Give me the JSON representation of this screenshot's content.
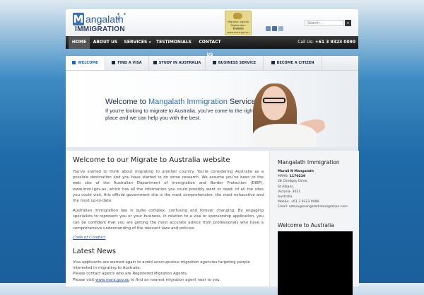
{
  "logo": {
    "brand": "angalath",
    "initial": "M",
    "sub": "IMMIGRATION"
  },
  "badge": {
    "line1": "Migration Agents",
    "line2": "Registration Number",
    "line3": "1170229",
    "line4": "www.mara.gov.au"
  },
  "search": {
    "placeholder": "Search..."
  },
  "nav": {
    "items": [
      "HOME",
      "ABOUT US",
      "SERVICES ▫",
      "TESTIMONIALS",
      "CONTACT US"
    ],
    "phone_label": "Call Us:",
    "phone": "+61 3 9323 0090"
  },
  "tabs": [
    "WELCOME",
    "FIND A VISA",
    "STUDY IN AUSTRALIA",
    "BUSINESS SERVICE",
    "BECOME A CITIZEN"
  ],
  "banner": {
    "title_prefix": "Welcome to ",
    "title_brand": "Mangalath Immigration",
    "title_suffix": " Services",
    "text": "If you're looking to migrate to Australia, you've come to the right place and we can help you with the best."
  },
  "main": {
    "heading": "Welcome to our Migrate to Australia website",
    "para1": "You've started to think about migrating to another country. You're considering Australia as a possible destination and you have started to do some research. We assume you've been to the web site of the Australian Department of Immigration and Border Protection (DIBP), www.immi.gov.au, which has all the information you could possibly want or need: of all the sites you could visit, this official government site is the most comprehensive, the most exhaustive and the most up-to-date.",
    "para2": "Australian immigration law is quite complex, confusing and forever changing. By engaging specialists to represent you or your business, in relation to a visa or sponsorship application, you can be confident that you are getting the most accurate advice from professionals who have a comprehensive understanding of the relevant laws and policies.",
    "coc_link": "Code of Conduct",
    "news_heading": "Latest News",
    "news1": "Visa applicants are warned again to avoid unscrupulous migration agencies targeting people interested in migrating to Australia.",
    "news2": "Please contact agents who are Registered Migration Agents.",
    "news3_prefix": "Please visit ",
    "news3_link": "www.mara.gov.au",
    "news3_suffix": " to find an nearest migration agent near to you."
  },
  "side": {
    "heading": "Mangalath Immigration",
    "name": "Murali N Mangalath",
    "marn_label": "MARN:",
    "marn": "1170229",
    "addr1": "28 Chedgey Drive,",
    "addr2": "St Albans,",
    "addr3": "Victoria- 3021",
    "addr4": "Australia.",
    "mobile": "Mobile: +61 3 9323 0090",
    "email": "Email: admin@mangalathimmigration.com",
    "video_heading": "Welcome to Australia"
  }
}
